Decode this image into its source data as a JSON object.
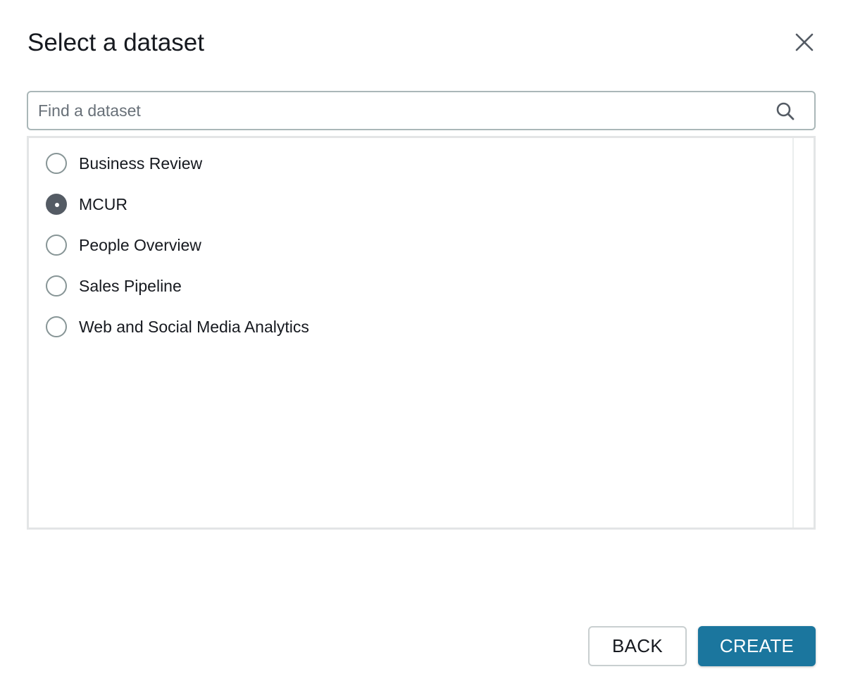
{
  "dialog": {
    "title": "Select a dataset",
    "close_icon": "close-icon"
  },
  "search": {
    "placeholder": "Find a dataset",
    "value": "",
    "icon": "search-icon"
  },
  "datasets": {
    "items": [
      {
        "label": "Business Review",
        "selected": false
      },
      {
        "label": "MCUR",
        "selected": true
      },
      {
        "label": "People Overview",
        "selected": false
      },
      {
        "label": "Sales Pipeline",
        "selected": false
      },
      {
        "label": "Web and Social Media Analytics",
        "selected": false
      }
    ]
  },
  "footer": {
    "back_label": "BACK",
    "create_label": "CREATE"
  },
  "colors": {
    "primary": "#1b769e",
    "radio_checked": "#545b64",
    "border": "#aab7b8"
  }
}
